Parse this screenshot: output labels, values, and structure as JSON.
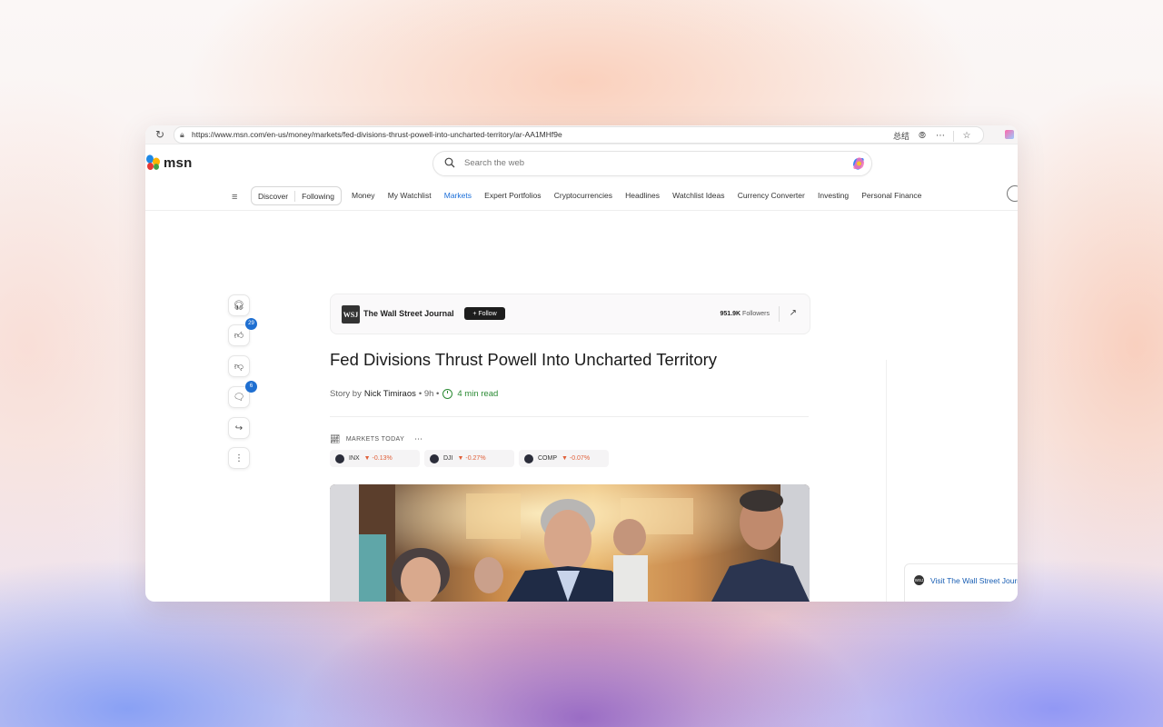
{
  "browser": {
    "url": "https://www.msn.com/en-us/money/markets/fed-divisions-thrust-powell-into-uncharted-territory/ar-AA1MHf9e",
    "right_label": "总结"
  },
  "header": {
    "logo_text": "msn",
    "search_placeholder": "Search the web"
  },
  "nav": {
    "pill": [
      "Discover",
      "Following"
    ],
    "items": [
      {
        "label": "Money"
      },
      {
        "label": "My Watchlist"
      },
      {
        "label": "Markets",
        "active": true
      },
      {
        "label": "Expert Portfolios"
      },
      {
        "label": "Cryptocurrencies"
      },
      {
        "label": "Headlines"
      },
      {
        "label": "Watchlist Ideas"
      },
      {
        "label": "Currency Converter"
      },
      {
        "label": "Investing"
      },
      {
        "label": "Personal Finance"
      }
    ]
  },
  "rail": {
    "like_count": "29",
    "comment_count": "6"
  },
  "publisher": {
    "logo": "WSJ",
    "name": "The Wall Street Journal",
    "follow_label": "+ Follow",
    "followers_count": "951.9K",
    "followers_label": "Followers"
  },
  "article": {
    "title": "Fed Divisions Thrust Powell Into Uncharted Territory",
    "story_by": "Story by",
    "author": "Nick Timiraos",
    "age": "• 9h •",
    "read_time": "4 min read"
  },
  "markets": {
    "label": "MARKETS TODAY",
    "tickers": [
      {
        "symbol": "INX",
        "change": "-0.13%"
      },
      {
        "symbol": "DJI",
        "change": "-0.27%"
      },
      {
        "symbol": "COMP",
        "change": "-0.07%"
      }
    ]
  },
  "visit": {
    "label": "Visit The Wall Street Journ"
  },
  "colors": {
    "accent": "#1a6ed8",
    "down": "#e0603a",
    "read_time": "#2a8a33"
  }
}
